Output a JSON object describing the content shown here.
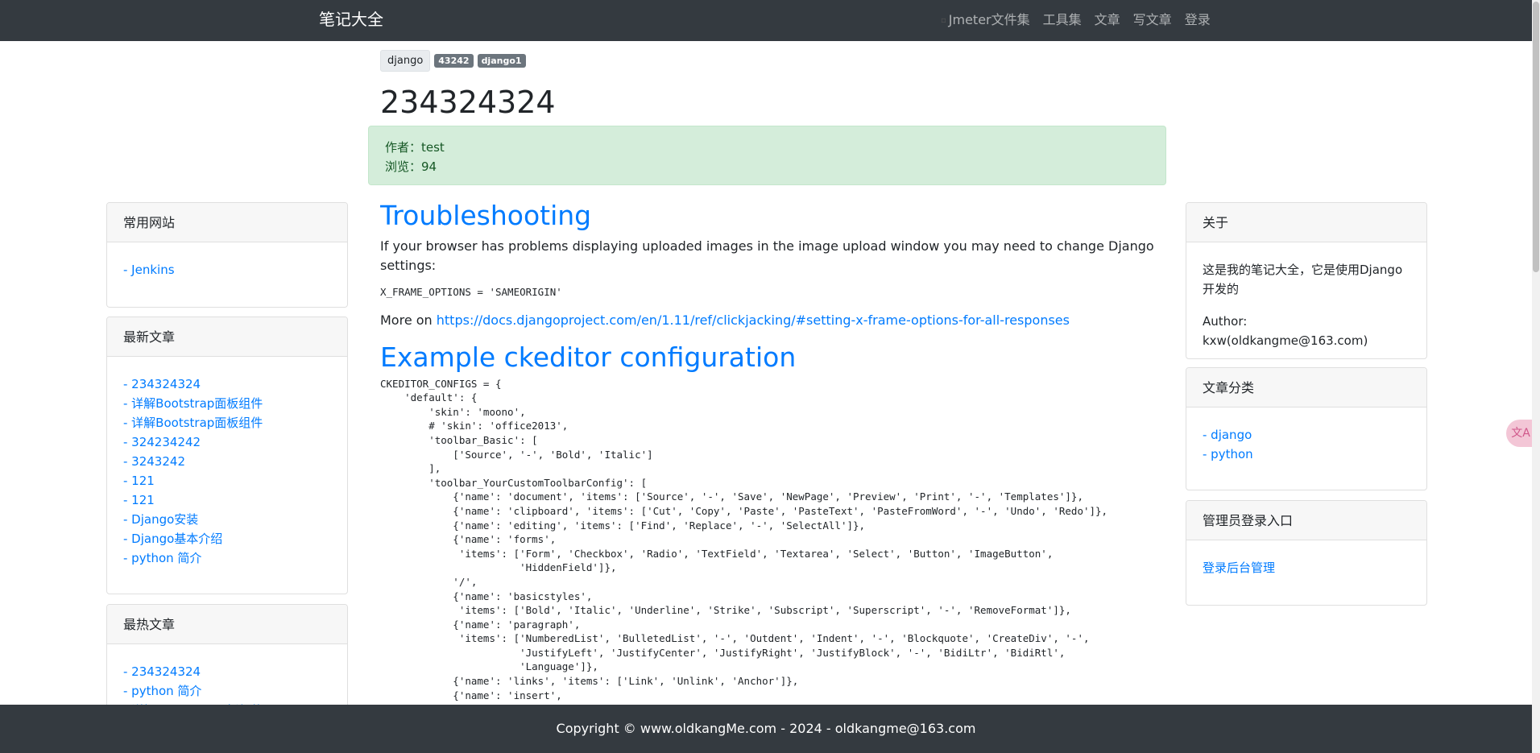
{
  "navbar": {
    "brand": "笔记大全",
    "items": [
      "Jmeter文件集",
      "工具集",
      "文章",
      "写文章",
      "登录"
    ]
  },
  "post": {
    "category": "django",
    "tags": [
      "43242",
      "django1"
    ],
    "title": "234324324",
    "author_line": "作者：test",
    "views_line": "浏览：94"
  },
  "content": {
    "h1": "Troubleshooting",
    "p1": "If your browser has problems displaying uploaded images in the image upload window you may need to change Django settings:",
    "code1": "X_FRAME_OPTIONS = 'SAMEORIGIN'",
    "more_prefix": "More on ",
    "more_link": "https://docs.djangoproject.com/en/1.11/ref/clickjacking/#setting-x-frame-options-for-all-responses",
    "h2": "Example ckeditor configuration",
    "code2": "CKEDITOR_CONFIGS = {\n    'default': {\n        'skin': 'moono',\n        # 'skin': 'office2013',\n        'toolbar_Basic': [\n            ['Source', '-', 'Bold', 'Italic']\n        ],\n        'toolbar_YourCustomToolbarConfig': [\n            {'name': 'document', 'items': ['Source', '-', 'Save', 'NewPage', 'Preview', 'Print', '-', 'Templates']},\n            {'name': 'clipboard', 'items': ['Cut', 'Copy', 'Paste', 'PasteText', 'PasteFromWord', '-', 'Undo', 'Redo']},\n            {'name': 'editing', 'items': ['Find', 'Replace', '-', 'SelectAll']},\n            {'name': 'forms',\n             'items': ['Form', 'Checkbox', 'Radio', 'TextField', 'Textarea', 'Select', 'Button', 'ImageButton',\n                       'HiddenField']},\n            '/',\n            {'name': 'basicstyles',\n             'items': ['Bold', 'Italic', 'Underline', 'Strike', 'Subscript', 'Superscript', '-', 'RemoveFormat']},\n            {'name': 'paragraph',\n             'items': ['NumberedList', 'BulletedList', '-', 'Outdent', 'Indent', '-', 'Blockquote', 'CreateDiv', '-',\n                       'JustifyLeft', 'JustifyCenter', 'JustifyRight', 'JustifyBlock', '-', 'BidiLtr', 'BidiRtl',\n                       'Language']},\n            {'name': 'links', 'items': ['Link', 'Unlink', 'Anchor']},\n            {'name': 'insert',\n             'items': ['Image', 'Flash', 'Table', 'HorizontalRule', 'Smiley', 'SpecialChar', 'PageBreak', 'Iframe']},"
  },
  "left": {
    "sites_title": "常用网站",
    "sites": [
      "- Jenkins"
    ],
    "latest_title": "最新文章",
    "latest": [
      "- 234324324",
      "- 详解Bootstrap面板组件",
      "- 详解Bootstrap面板组件",
      "- 324234242",
      "- 3243242",
      "- 121",
      "- 121",
      "- Django安装",
      "- Django基本介绍",
      "- python 简介"
    ],
    "hot_title": "最热文章",
    "hot": [
      "- 234324324",
      "- python 简介",
      "- 详解Bootstrap面板组件"
    ]
  },
  "right": {
    "about_title": "关于",
    "about_text": "这是我的笔记大全，它是使用Django开发的",
    "author": "Author: kxw(oldkangme@163.com)",
    "cat_title": "文章分类",
    "cats": [
      "- django",
      "- python"
    ],
    "admin_title": "管理员登录入口",
    "admin_link": "登录后台管理"
  },
  "footer": {
    "text": "Copyright © www.oldkangMe.com - 2024 - oldkangme@163.com"
  },
  "floating_icon": "translate-icon"
}
